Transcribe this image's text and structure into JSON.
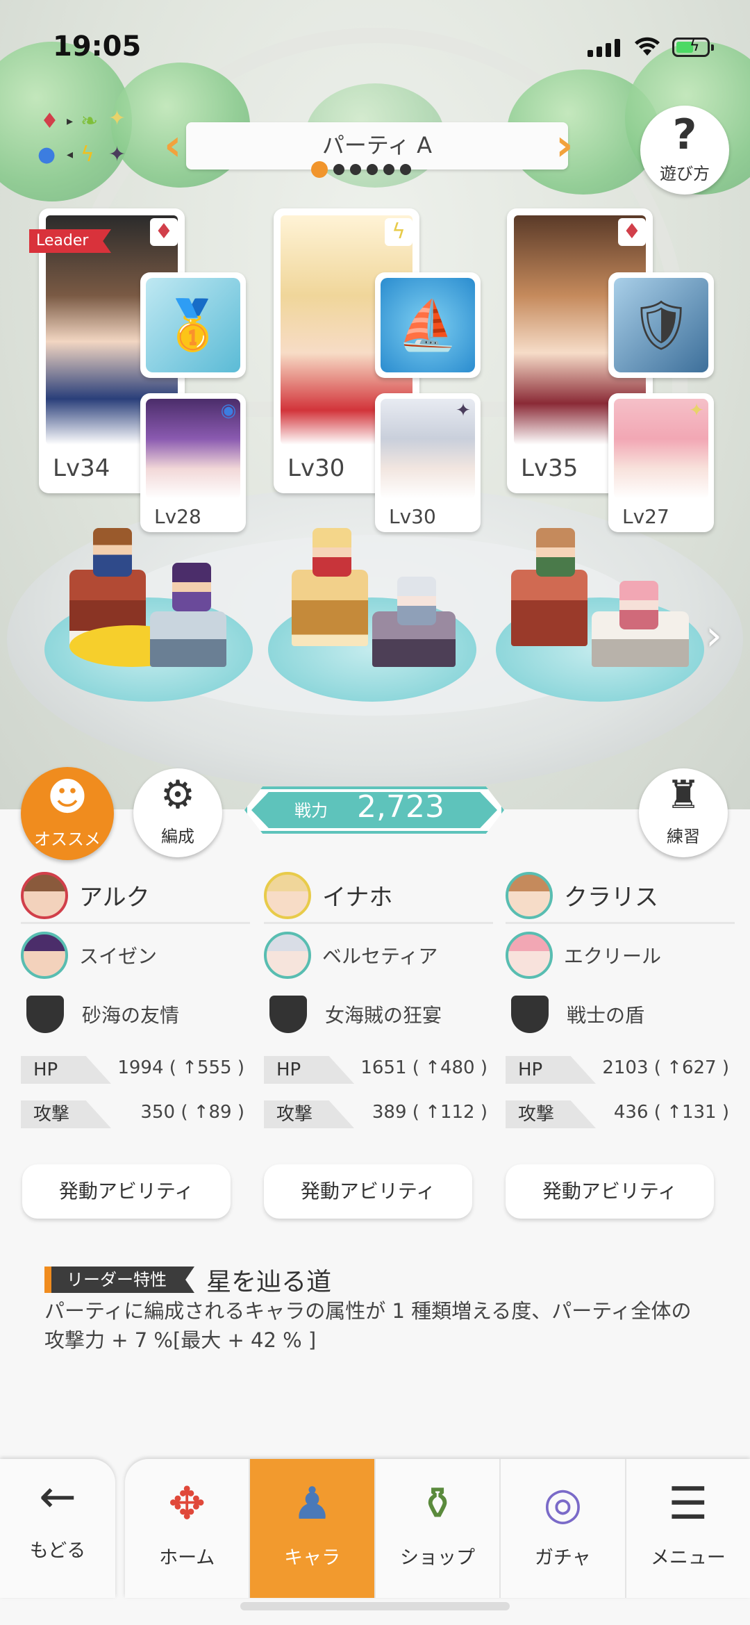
{
  "status_bar": {
    "time": "19:05"
  },
  "header": {
    "party_title": "パーティ A",
    "party_pages": 6,
    "party_current": 1,
    "help_label": "遊び方"
  },
  "leader_tag": "Leader",
  "units": [
    {
      "leader": {
        "level": "Lv34",
        "attr_icon": "fire-diamond-icon",
        "portrait_color": "#8a5a3c"
      },
      "equip_icon": "golden-boat-icon",
      "sub": {
        "level": "Lv28",
        "attr_icon": "water-circle-icon",
        "portrait_color": "#6b4a8a"
      }
    },
    {
      "leader": {
        "level": "Lv30",
        "attr_icon": "thunder-bolt-icon",
        "portrait_color": "#f0d69a"
      },
      "equip_icon": "ship-orb-icon",
      "sub": {
        "level": "Lv30",
        "attr_icon": "dark-star-icon",
        "portrait_color": "#d9dde6"
      }
    },
    {
      "leader": {
        "level": "Lv35",
        "attr_icon": "fire-diamond-icon",
        "portrait_color": "#c58a5c"
      },
      "equip_icon": "blue-shield-icon",
      "sub": {
        "level": "Lv27",
        "attr_icon": "light-star-icon",
        "portrait_color": "#f2a7b4"
      }
    }
  ],
  "actions": {
    "recommend": "オススメ",
    "formation": "編成",
    "practice": "練習",
    "power_label": "戦力",
    "power_value": "2,723"
  },
  "columns": [
    {
      "leader_name": "アルク",
      "sub_name": "スイゼン",
      "skill": "砂海の友情",
      "hp_label": "HP",
      "hp": "1994 ( ↑555 )",
      "atk_label": "攻撃",
      "atk": "350 ( ↑89 )",
      "ability": "発動アビリティ"
    },
    {
      "leader_name": "イナホ",
      "sub_name": "ベルセティア",
      "skill": "女海賊の狂宴",
      "hp_label": "HP",
      "hp": "1651 ( ↑480 )",
      "atk_label": "攻撃",
      "atk": "389 ( ↑112 )",
      "ability": "発動アビリティ"
    },
    {
      "leader_name": "クラリス",
      "sub_name": "エクリール",
      "skill": "戦士の盾",
      "hp_label": "HP",
      "hp": "2103 ( ↑627 )",
      "atk_label": "攻撃",
      "atk": "436 ( ↑131 )",
      "ability": "発動アビリティ"
    }
  ],
  "leader_trait": {
    "tag": "リーダー特性",
    "name": "星を辿る道",
    "description": "パーティに編成されるキャラの属性が 1 種類増える度、パーティ全体の攻撃力 + 7 %[最大 + 42 % ]"
  },
  "nav": {
    "back": "もどる",
    "tabs": [
      {
        "label": "ホーム",
        "icon": "home-icon",
        "active": false
      },
      {
        "label": "キャラ",
        "icon": "character-icon",
        "active": true
      },
      {
        "label": "ショップ",
        "icon": "shop-icon",
        "active": false
      },
      {
        "label": "ガチャ",
        "icon": "gacha-icon",
        "active": false
      },
      {
        "label": "メニュー",
        "icon": "menu-icon",
        "active": false
      }
    ]
  },
  "colors": {
    "accent": "#f29a2e",
    "power": "#5ec3bb",
    "fire": "#d13f4a",
    "thunder": "#e8cb4a",
    "teal": "#58bdb1"
  }
}
